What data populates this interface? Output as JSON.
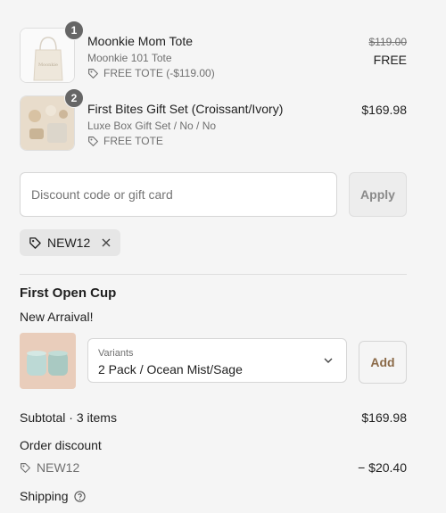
{
  "line_items": [
    {
      "quantity": "1",
      "title": "Moonkie Mom Tote",
      "variant": "Moonkie 101 Tote",
      "tag_icon": "tag-icon",
      "discount": "FREE TOTE (-$119.00)",
      "original_price": "$119.00",
      "price": "FREE"
    },
    {
      "quantity": "2",
      "title": "First Bites Gift Set (Croissant/Ivory)",
      "variant": "Luxe Box Gift Set / No / No",
      "tag_icon": "tag-icon",
      "discount": "FREE TOTE",
      "price": "$169.98"
    }
  ],
  "discount": {
    "placeholder": "Discount code or gift card",
    "apply_label": "Apply",
    "applied_code": "NEW12"
  },
  "upsell": {
    "title": "First Open Cup",
    "subtitle": "New Arraival!",
    "variant_label": "Variants",
    "variant_value": "2 Pack / Ocean Mist/Sage",
    "add_label": "Add"
  },
  "summary": {
    "subtotal_label": "Subtotal · 3 items",
    "subtotal_value": "$169.98",
    "order_discount_label": "Order discount",
    "discount_code": "NEW12",
    "discount_value": "− $20.40",
    "shipping_label": "Shipping"
  },
  "colors": {
    "background": "#f5f5f5",
    "badge": "#666666",
    "add_button_text": "#8b6a48"
  }
}
